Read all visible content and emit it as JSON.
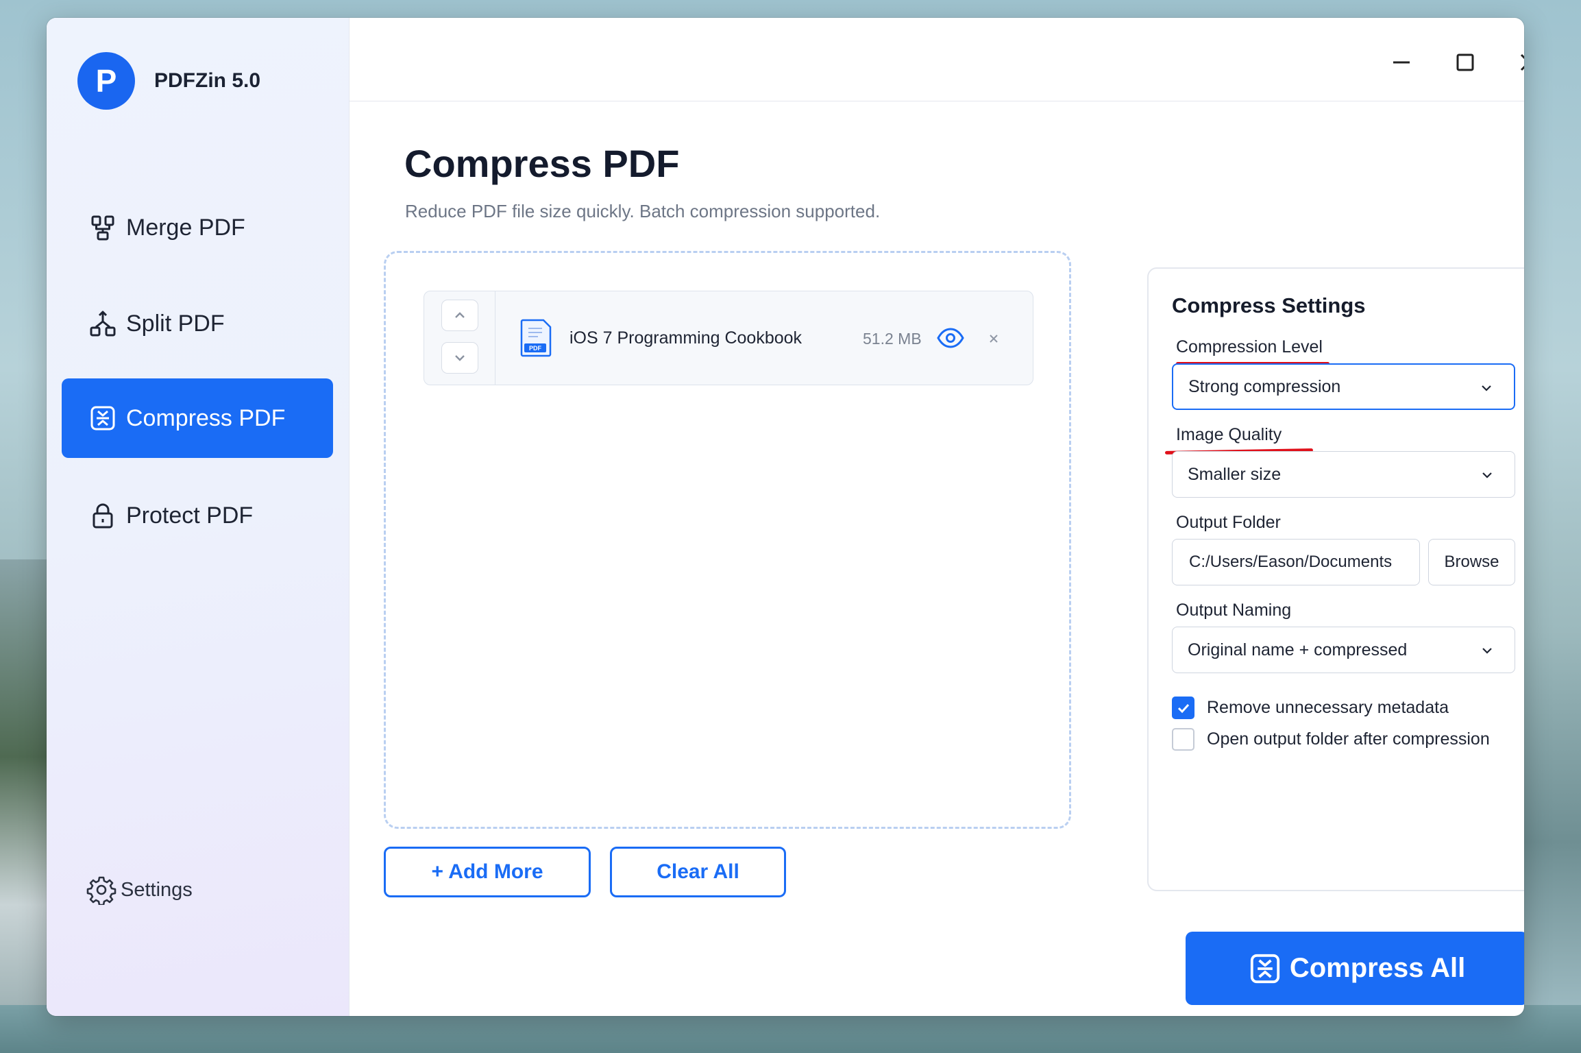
{
  "app": {
    "logo_letter": "P",
    "name": "PDFZin 5.0"
  },
  "sidebar": {
    "items": [
      {
        "label": "Merge PDF",
        "icon": "merge-icon"
      },
      {
        "label": "Split PDF",
        "icon": "split-icon"
      },
      {
        "label": "Compress PDF",
        "icon": "compress-icon",
        "active": true
      },
      {
        "label": "Protect PDF",
        "icon": "lock-icon"
      }
    ],
    "settings_label": "Settings"
  },
  "window_controls": [
    "minimize-icon",
    "maximize-icon",
    "close-icon"
  ],
  "main": {
    "title": "Compress PDF",
    "subtitle": "Reduce PDF file size quickly. Batch compression supported.",
    "files": [
      {
        "name": "iOS 7 Programming Cookbook",
        "size": "51.2 MB",
        "icon_text": "PDF"
      }
    ],
    "add_more_label": "+ Add More",
    "clear_all_label": "Clear All",
    "compress_all_label": "Compress All"
  },
  "settings": {
    "title": "Compress Settings",
    "compression_level": {
      "label": "Compression Level",
      "value": "Strong compression"
    },
    "image_quality": {
      "label": "Image Quality",
      "value": "Smaller size"
    },
    "output_folder": {
      "label": "Output Folder",
      "value": "C:/Users/Eason/Documents",
      "browse_label": "Browse"
    },
    "output_naming": {
      "label": "Output Naming",
      "value": "Original name + compressed"
    },
    "remove_metadata": {
      "label": "Remove unnecessary metadata",
      "checked": true
    },
    "open_folder": {
      "label": "Open output folder after compression",
      "checked": false
    }
  },
  "colors": {
    "accent": "#1a6cf5",
    "annotation": "#e0101a"
  }
}
